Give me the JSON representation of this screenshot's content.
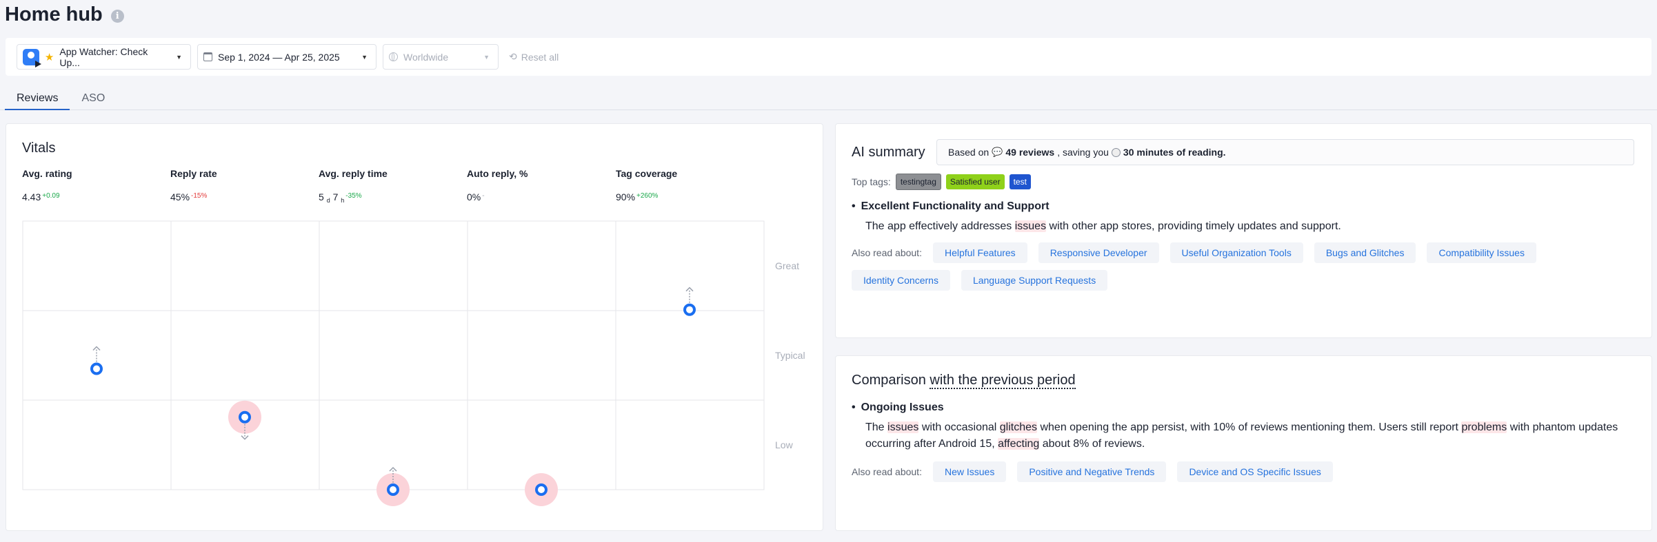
{
  "header": {
    "title": "Home hub"
  },
  "filters": {
    "app": "App Watcher: Check Up...",
    "date_range": "Sep 1, 2024 — Apr 25, 2025",
    "region": "Worldwide",
    "reset": "Reset all"
  },
  "tabs": [
    {
      "label": "Reviews",
      "active": true
    },
    {
      "label": "ASO",
      "active": false
    }
  ],
  "vitals": {
    "title": "Vitals",
    "metrics": [
      {
        "label": "Avg. rating",
        "value": "4.43",
        "delta": "+0.09",
        "delta_type": "pos"
      },
      {
        "label": "Reply rate",
        "value": "45%",
        "delta": "-15%",
        "delta_type": "neg"
      },
      {
        "label": "Avg. reply time",
        "value_a": "5",
        "unit_a": "d",
        "value_b": "7",
        "unit_b": "h",
        "delta": "-35%",
        "delta_type": "pos"
      },
      {
        "label": "Auto reply, %",
        "value": "0%",
        "delta": "-",
        "delta_type": "neutral"
      },
      {
        "label": "Tag coverage",
        "value": "90%",
        "delta": "+260%",
        "delta_type": "pos"
      }
    ],
    "levels": [
      "Great",
      "Typical",
      "Low"
    ],
    "markers": [
      {
        "metric": "Avg. rating",
        "level": 0.45,
        "trend": "up",
        "alert": false
      },
      {
        "metric": "Reply rate",
        "level": 0.27,
        "trend": "down",
        "alert": true
      },
      {
        "metric": "Avg. reply time",
        "level": 0.0,
        "trend": "up",
        "alert": true
      },
      {
        "metric": "Auto reply, %",
        "level": 0.0,
        "trend": "none",
        "alert": true
      },
      {
        "metric": "Tag coverage",
        "level": 0.67,
        "trend": "up",
        "alert": false
      }
    ],
    "colors": {
      "marker": "#1a6ef0",
      "alert": "#fbd3d9",
      "grid": "#e4e6ea"
    }
  },
  "summary": {
    "title": "AI summary",
    "banner": {
      "prefix": "Based on",
      "reviews": "49 reviews",
      "middle": ", saving you",
      "minutes": "30 minutes of reading."
    },
    "top_tags_label": "Top tags:",
    "tags": [
      "testingtag",
      "Satisfied user",
      "test"
    ],
    "point_title": "Excellent Functionality and Support",
    "point_text_1": "The app effectively addresses ",
    "point_hl_1": "issues",
    "point_text_2": " with other app stores, providing timely updates and support.",
    "also_label": "Also read about:",
    "also_topics": [
      "Helpful Features",
      "Responsive Developer",
      "Useful Organization Tools",
      "Bugs and Glitches",
      "Compatibility Issues",
      "Identity Concerns",
      "Language Support Requests"
    ]
  },
  "comparison": {
    "title_prefix": "Comparison",
    "title_link": "with the previous period",
    "point_title": "Ongoing Issues",
    "t1": "The ",
    "h1": "issues",
    "t2": " with occasional ",
    "h2": "glitches",
    "t3": " when opening the app persist, with 10% of reviews mentioning them. Users still report ",
    "h3": "problems",
    "t4": " with phantom updates occurring after Android 15, ",
    "h4": "affecting",
    "t5": " about 8% of reviews.",
    "also_label": "Also read about:",
    "also_topics": [
      "New Issues",
      "Positive and Negative Trends",
      "Device and OS Specific Issues"
    ]
  }
}
